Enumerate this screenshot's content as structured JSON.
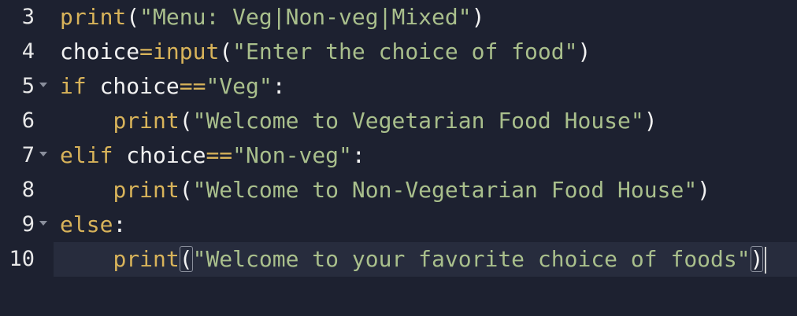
{
  "editor": {
    "lines": [
      {
        "number": "3",
        "foldable": false,
        "indent": "",
        "tokens": [
          {
            "text": "print",
            "cls": "fn"
          },
          {
            "text": "(",
            "cls": "pl"
          },
          {
            "text": "\"Menu: Veg|Non-veg|Mixed\"",
            "cls": "str"
          },
          {
            "text": ")",
            "cls": "pl"
          }
        ]
      },
      {
        "number": "4",
        "foldable": false,
        "indent": "",
        "tokens": [
          {
            "text": "choice",
            "cls": "pl"
          },
          {
            "text": "=",
            "cls": "op"
          },
          {
            "text": "input",
            "cls": "fn"
          },
          {
            "text": "(",
            "cls": "pl"
          },
          {
            "text": "\"Enter the choice of food\"",
            "cls": "str"
          },
          {
            "text": ")",
            "cls": "pl"
          }
        ]
      },
      {
        "number": "5",
        "foldable": true,
        "indent": "",
        "tokens": [
          {
            "text": "if",
            "cls": "kw"
          },
          {
            "text": " choice",
            "cls": "pl"
          },
          {
            "text": "==",
            "cls": "op"
          },
          {
            "text": "\"Veg\"",
            "cls": "str"
          },
          {
            "text": ":",
            "cls": "pl"
          }
        ]
      },
      {
        "number": "6",
        "foldable": false,
        "indent": "    ",
        "tokens": [
          {
            "text": "print",
            "cls": "fn"
          },
          {
            "text": "(",
            "cls": "pl"
          },
          {
            "text": "\"Welcome to Vegetarian Food House\"",
            "cls": "str"
          },
          {
            "text": ")",
            "cls": "pl"
          }
        ]
      },
      {
        "number": "7",
        "foldable": true,
        "indent": "",
        "tokens": [
          {
            "text": "elif",
            "cls": "kw"
          },
          {
            "text": " choice",
            "cls": "pl"
          },
          {
            "text": "==",
            "cls": "op"
          },
          {
            "text": "\"Non-veg\"",
            "cls": "str"
          },
          {
            "text": ":",
            "cls": "pl"
          }
        ]
      },
      {
        "number": "8",
        "foldable": false,
        "indent": "    ",
        "tokens": [
          {
            "text": "print",
            "cls": "fn"
          },
          {
            "text": "(",
            "cls": "pl"
          },
          {
            "text": "\"Welcome to Non-Vegetarian Food House\"",
            "cls": "str"
          },
          {
            "text": ")",
            "cls": "pl"
          }
        ]
      },
      {
        "number": "9",
        "foldable": true,
        "indent": "",
        "tokens": [
          {
            "text": "else",
            "cls": "kw"
          },
          {
            "text": ":",
            "cls": "pl"
          }
        ]
      },
      {
        "number": "10",
        "foldable": false,
        "indent": "    ",
        "active": true,
        "tokens": [
          {
            "text": "print",
            "cls": "fn"
          },
          {
            "text": "(",
            "cls": "pl",
            "bracket": true
          },
          {
            "text": "\"Welcome to your favorite choice of foods\"",
            "cls": "str"
          },
          {
            "text": ")",
            "cls": "pl",
            "bracket": true
          }
        ]
      }
    ],
    "colors": {
      "background": "#1d2130",
      "keyword": "#d8b35a",
      "string": "#a9bf8c",
      "text": "#f2f2f2"
    }
  }
}
